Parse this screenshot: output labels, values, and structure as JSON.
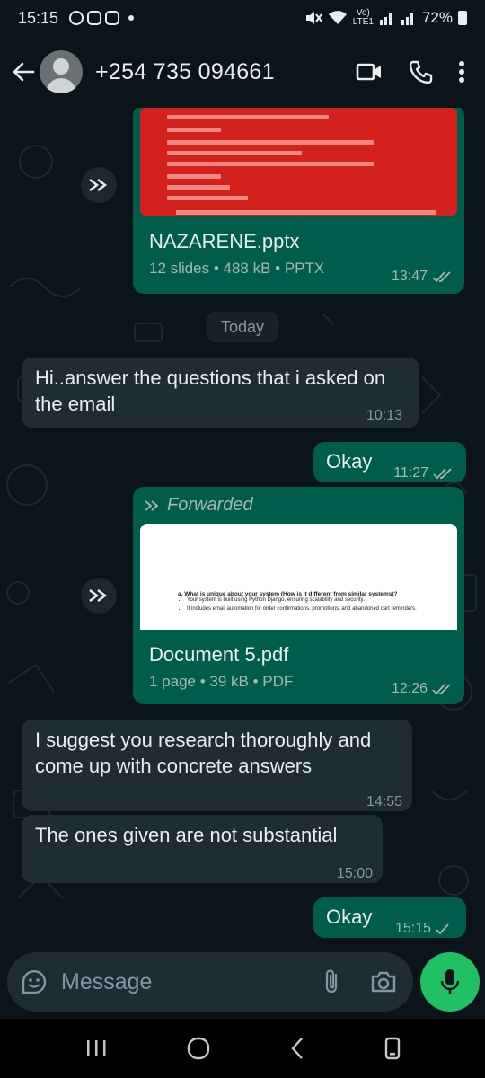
{
  "status_bar": {
    "time": "15:15",
    "network_top": "Vo)",
    "network_bottom": "LTE1",
    "battery": "72%"
  },
  "header": {
    "contact_name": "+254 735 094661"
  },
  "messages": {
    "doc1": {
      "name": "NAZARENE.pptx",
      "info": "12 slides • 488 kB • PPTX",
      "time": "13:47"
    },
    "date_divider": "Today",
    "msg1": {
      "text": "Hi..answer the questions that i asked on the email",
      "time": "10:13"
    },
    "msg2": {
      "text": "Okay",
      "time": "11:27"
    },
    "doc2": {
      "forwarded_label": "Forwarded",
      "preview_question": "a. What is unique about your system (How is it different from similar systems)?",
      "preview_bullet1": "Your system is built using Python Django, ensuring scalability and security.",
      "preview_bullet2": "It includes email automation for order confirmations, promotions, and abandoned cart reminders.",
      "name": "Document 5.pdf",
      "info": "1 page • 39 kB • PDF",
      "time": "12:26"
    },
    "msg3": {
      "text": "I suggest you research thoroughly and come up with concrete answers",
      "time": "14:55"
    },
    "msg4": {
      "text": "The ones given are not substantial",
      "time": "15:00"
    },
    "msg5": {
      "text": "Okay",
      "time": "15:15"
    }
  },
  "composer": {
    "placeholder": "Message"
  },
  "colors": {
    "background": "#0b141a",
    "outgoing_bubble": "#005c4b",
    "incoming_bubble": "#202c33",
    "accent_green": "#21c063",
    "read_tick": "#a7b7b3"
  }
}
